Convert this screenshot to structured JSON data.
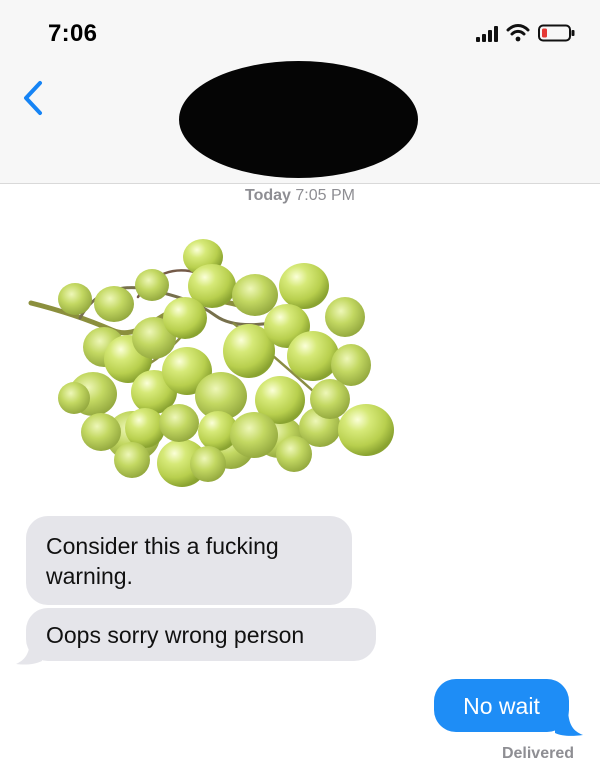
{
  "status_bar": {
    "time": "7:06",
    "icons": [
      "cellular-signal-icon",
      "wifi-icon",
      "battery-icon"
    ]
  },
  "navigation": {
    "back_icon": "chevron-left-icon",
    "contact_name_redacted": true
  },
  "conversation": {
    "timestamp_day": "Today",
    "timestamp_time": "7:05 PM",
    "photo_subject": "green grapes",
    "messages": [
      {
        "sender": "incoming",
        "text": "Consider this a fucking warning."
      },
      {
        "sender": "incoming",
        "text": "Oops sorry wrong person"
      },
      {
        "sender": "outgoing",
        "text": "No wait"
      }
    ],
    "delivery_status": "Delivered"
  },
  "colors": {
    "header_background": "#f7f7f7",
    "incoming_bubble": "#e5e5ea",
    "outgoing_bubble": "#1e8df6",
    "ios_blue": "#007aff",
    "metadata_gray": "#8e8e93"
  }
}
